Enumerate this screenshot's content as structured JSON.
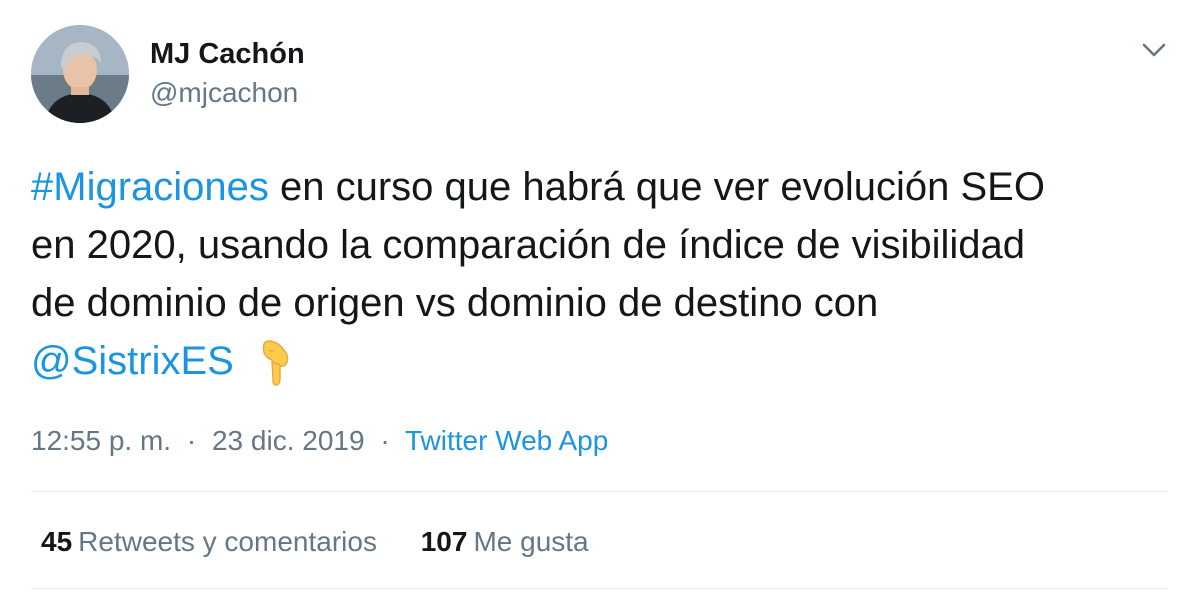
{
  "author": {
    "display_name": "MJ Cachón",
    "handle": "@mjcachon"
  },
  "tweet": {
    "line1": {
      "hashtag": "#Migraciones",
      "rest": " en curso que habrá que ver evolución SEO"
    },
    "line2": "en 2020, usando la comparación de índice de visibilidad",
    "line3": "de dominio de origen vs dominio de destino con",
    "line4": {
      "mention": "@SistrixES",
      "emoji": "backhand-index-pointing-down"
    }
  },
  "meta": {
    "time": "12:55 p. m.",
    "separator": "·",
    "date": "23 dic. 2019",
    "source": "Twitter Web App"
  },
  "stats": {
    "retweets_count": "45",
    "retweets_label": "Retweets y comentarios",
    "likes_count": "107",
    "likes_label": "Me gusta"
  },
  "colors": {
    "link": "#1b95e0",
    "text": "#14171a",
    "secondary": "#657786",
    "divider": "#e1e8ed"
  },
  "icons": {
    "caret": "chevron-down-icon",
    "emoji": "pointing-down-emoji"
  }
}
